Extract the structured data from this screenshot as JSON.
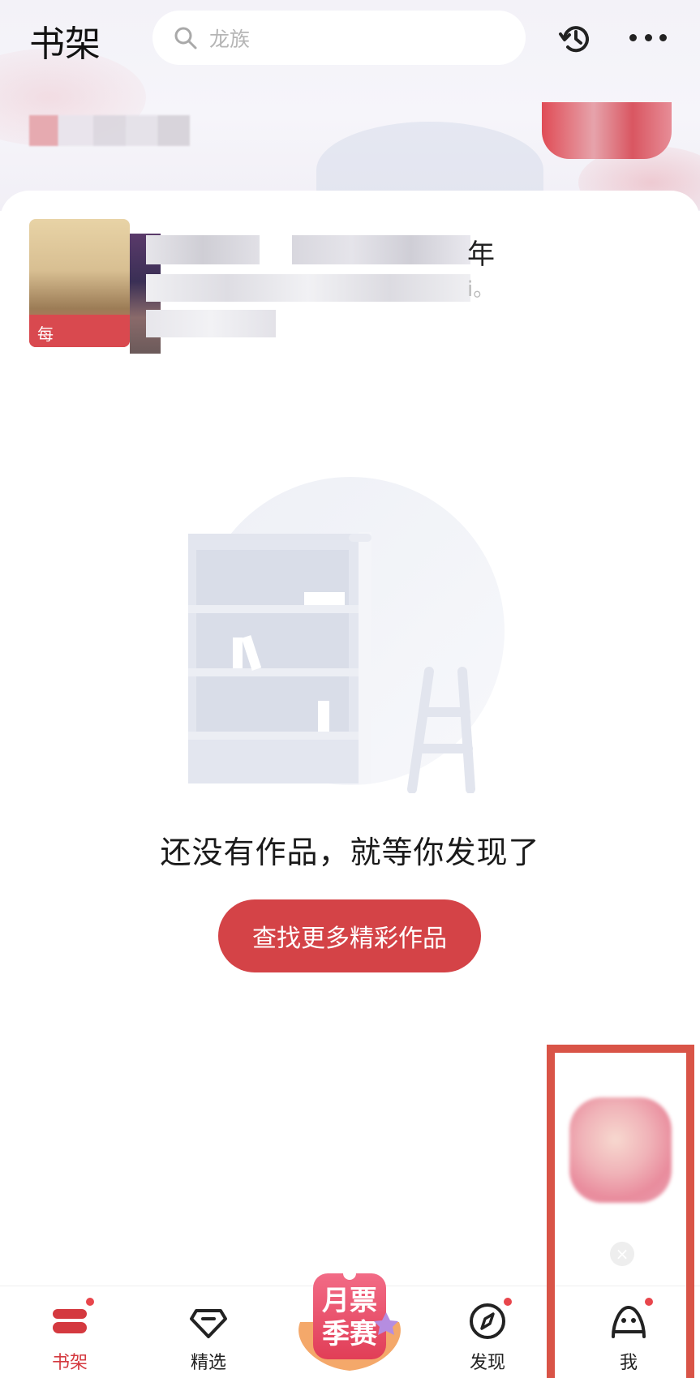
{
  "header": {
    "title": "书架",
    "search_placeholder": "龙族"
  },
  "promo": {
    "cover_badge": "每",
    "tail_char": "年",
    "tail_subtext": "i。"
  },
  "empty_state": {
    "message": "还没有作品，就等你发现了",
    "cta_label": "查找更多精彩作品"
  },
  "float_widget": {
    "close_symbol": "×"
  },
  "bottom_nav": {
    "items": [
      {
        "label": "书架",
        "active": true,
        "badge_dot": true
      },
      {
        "label": "精选",
        "active": false,
        "badge_dot": false
      },
      {
        "label": "发现",
        "active": false,
        "badge_dot": true
      },
      {
        "label": "我",
        "active": false,
        "badge_dot": true
      }
    ],
    "center_badge": {
      "line1": "月票",
      "line2": "季赛"
    }
  },
  "colors": {
    "accent": "#d44347",
    "highlight": "#d95447",
    "text": "#1a1a1a",
    "placeholder": "#b5b5b5"
  }
}
